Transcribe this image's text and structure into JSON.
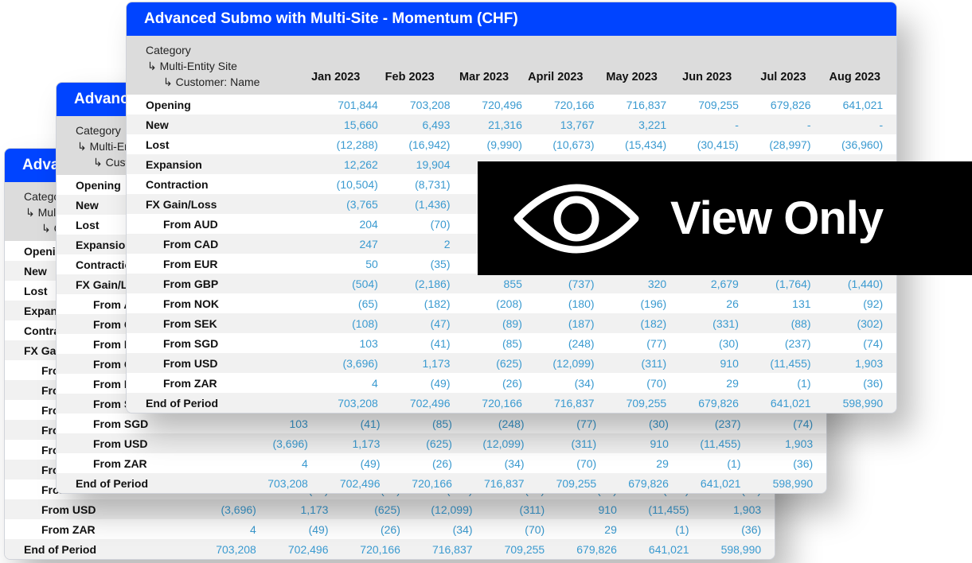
{
  "table": {
    "title": "Advanced Submo with Multi-Site - Momentum (CHF)",
    "header": {
      "category": "Category",
      "level1": "↳ Multi-Entity Site",
      "level2": "↳ Customer: Name"
    },
    "months": [
      "Jan 2023",
      "Feb 2023",
      "Mar 2023",
      "April 2023",
      "May 2023",
      "Jun 2023",
      "Jul 2023",
      "Aug 2023"
    ],
    "rows": [
      {
        "label": "Opening",
        "sub": false,
        "values": [
          "701,844",
          "703,208",
          "720,496",
          "720,166",
          "716,837",
          "709,255",
          "679,826",
          "641,021"
        ]
      },
      {
        "label": "New",
        "sub": false,
        "values": [
          "15,660",
          "6,493",
          "21,316",
          "13,767",
          "3,221",
          "-",
          "-",
          "-"
        ]
      },
      {
        "label": "Lost",
        "sub": false,
        "values": [
          "(12,288)",
          "(16,942)",
          "(9,990)",
          "(10,673)",
          "(15,434)",
          "(30,415)",
          "(28,997)",
          "(36,960)"
        ]
      },
      {
        "label": "Expansion",
        "sub": false,
        "values": [
          "12,262",
          "19,904",
          null,
          null,
          null,
          null,
          null,
          null
        ]
      },
      {
        "label": "Contraction",
        "sub": false,
        "values": [
          "(10,504)",
          "(8,731)",
          null,
          null,
          null,
          null,
          null,
          null
        ]
      },
      {
        "label": "FX Gain/Loss",
        "sub": false,
        "values": [
          "(3,765",
          "(1,436)",
          null,
          null,
          null,
          null,
          null,
          null
        ]
      },
      {
        "label": "From AUD",
        "sub": true,
        "values": [
          "204",
          "(70)",
          null,
          null,
          null,
          null,
          null,
          null
        ]
      },
      {
        "label": "From CAD",
        "sub": true,
        "values": [
          "247",
          "2",
          null,
          null,
          null,
          null,
          null,
          null
        ]
      },
      {
        "label": "From EUR",
        "sub": true,
        "values": [
          "50",
          "(35)",
          null,
          null,
          null,
          null,
          null,
          null
        ]
      },
      {
        "label": "From GBP",
        "sub": true,
        "values": [
          "(504)",
          "(2,186)",
          "855",
          "(737)",
          "320",
          "2,679",
          "(1,764)",
          "(1,440)"
        ]
      },
      {
        "label": "From NOK",
        "sub": true,
        "values": [
          "(65)",
          "(182)",
          "(208)",
          "(180)",
          "(196)",
          "26",
          "131",
          "(92)"
        ]
      },
      {
        "label": "From SEK",
        "sub": true,
        "values": [
          "(108)",
          "(47)",
          "(89)",
          "(187)",
          "(182)",
          "(331)",
          "(88)",
          "(302)"
        ]
      },
      {
        "label": "From SGD",
        "sub": true,
        "values": [
          "103",
          "(41)",
          "(85)",
          "(248)",
          "(77)",
          "(30)",
          "(237)",
          "(74)"
        ]
      },
      {
        "label": "From USD",
        "sub": true,
        "values": [
          "(3,696)",
          "1,173",
          "(625)",
          "(12,099)",
          "(311)",
          "910",
          "(11,455)",
          "1,903"
        ]
      },
      {
        "label": "From ZAR",
        "sub": true,
        "values": [
          "4",
          "(49)",
          "(26)",
          "(34)",
          "(70)",
          "29",
          "(1)",
          "(36)"
        ]
      },
      {
        "label": "End of Period",
        "sub": false,
        "values": [
          "703,208",
          "702,496",
          "720,166",
          "716,837",
          "709,255",
          "679,826",
          "641,021",
          "598,990"
        ]
      }
    ]
  },
  "overlay": {
    "icon": "eye-icon",
    "label": "View Only"
  },
  "colors": {
    "title_bar": "#0044ff",
    "value_text": "#3a9ad0",
    "header_bg": "#dcdcdc",
    "overlay_bg": "#000000"
  }
}
